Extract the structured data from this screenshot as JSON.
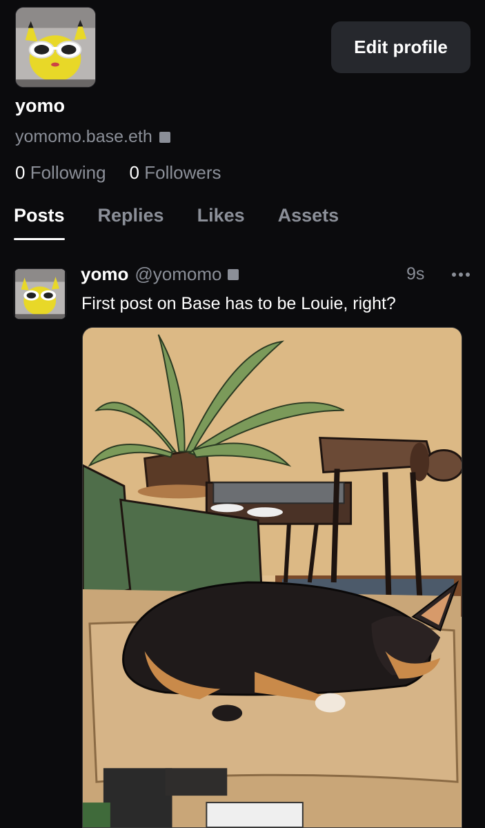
{
  "profile": {
    "display_name": "yomo",
    "handle": "yomomo.base.eth",
    "following_count": "0",
    "following_label": "Following",
    "followers_count": "0",
    "followers_label": "Followers",
    "edit_button": "Edit profile",
    "avatar_icon": "pikachu-sunglasses-avatar"
  },
  "tabs": [
    {
      "label": "Posts",
      "active": true
    },
    {
      "label": "Replies",
      "active": false
    },
    {
      "label": "Likes",
      "active": false
    },
    {
      "label": "Assets",
      "active": false
    }
  ],
  "post": {
    "author_name": "yomo",
    "author_handle": "@yomomo",
    "time": "9s",
    "text": "First post on Base has to be Louie, right?",
    "image_icon": "illustration-sleeping-dog"
  },
  "colors": {
    "background": "#0b0b0d",
    "muted_text": "#8b8f98",
    "button_bg": "#26282d"
  }
}
